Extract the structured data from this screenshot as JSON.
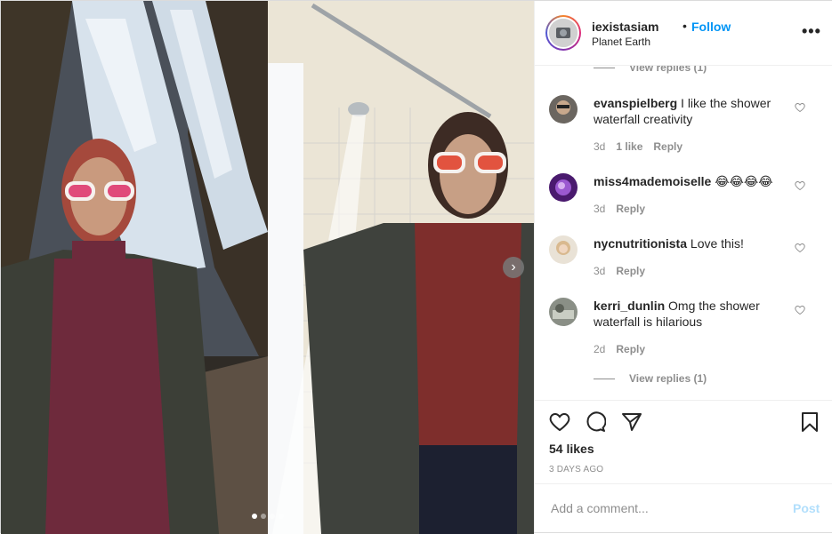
{
  "header": {
    "username": "iexistasiam",
    "separator": "•",
    "follow_label": "Follow",
    "location": "Planet Earth",
    "more_label": "•••"
  },
  "comments": {
    "top_view_replies": "View replies (1)",
    "items": [
      {
        "username": "evanspielberg",
        "text": "I like the shower waterfall creativity",
        "time": "3d",
        "likes": "1 like",
        "reply": "Reply"
      },
      {
        "username": "miss4mademoiselle",
        "text": "😂😂😂😂",
        "time": "3d",
        "reply": "Reply"
      },
      {
        "username": "nycnutritionista",
        "text": "Love this!",
        "time": "3d",
        "reply": "Reply"
      },
      {
        "username": "kerri_dunlin",
        "text": "Omg the shower waterfall is hilarious",
        "time": "2d",
        "reply": "Reply"
      }
    ],
    "bottom_view_replies": "View replies (1)"
  },
  "actions": {
    "likes": "54 likes",
    "date": "3 DAYS AGO"
  },
  "add_comment": {
    "placeholder": "Add a comment...",
    "post_label": "Post"
  },
  "carousel": {
    "next_label": "›",
    "dots": 4,
    "active_dot": 1
  },
  "colors": {
    "accent": "#0095f6",
    "post_disabled": "#b2dffc",
    "muted": "#8e8e8e"
  }
}
